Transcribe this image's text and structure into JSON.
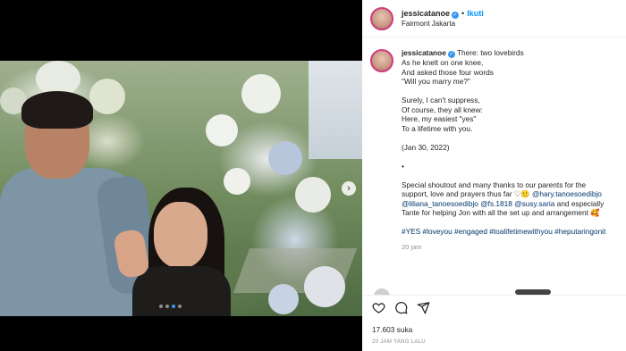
{
  "post": {
    "username": "jessicatanoe",
    "follow_label": "Ikuti",
    "separator": "•",
    "location": "Fairmont Jakarta"
  },
  "caption": {
    "username": "jessicatanoe",
    "first_line": "There: two lovebirds",
    "lines": [
      "As he knelt on one knee,",
      "And asked those four words",
      "\"Will you marry me?\"",
      "",
      "Surely, I can't suppress,",
      "Of course, they all knew:",
      "Here, my easiest \"yes\"",
      "To a lifetime with you.",
      "",
      "(Jan 30, 2022)",
      "",
      "•",
      "",
      "Special shoutout and many thanks to our parents for the"
    ],
    "line2_text": "support, love and prayers thus far ♡🙂 ",
    "mention1": "@hary.tanoesoedibjo",
    "mention2": "@liliana_tanoesoedibjo",
    "mention3": "@fs.1818",
    "mention4": "@susy.saria",
    "line3_tail": " and especially",
    "line4": "Tante for helping Jon with all the set up and arrangement 🥰",
    "hashtags": "#YES #loveyou #engaged #toalifetimewithyou #heputaringonit",
    "time_ago": "20 jam"
  },
  "carousel": {
    "next_icon": "chevron-right-icon",
    "next_glyph": "›",
    "dot_count": 4,
    "active_dot": 2
  },
  "actions": {
    "like_icon": "heart-icon",
    "comment_icon": "comment-icon",
    "share_icon": "share-icon",
    "likes_text": "17.603 suka",
    "date_text": "20 JAM YANG LALU"
  },
  "colors": {
    "accent": "#0095f6",
    "verified": "#3897f0",
    "mention": "#00376b",
    "muted": "#8e8e8e"
  }
}
